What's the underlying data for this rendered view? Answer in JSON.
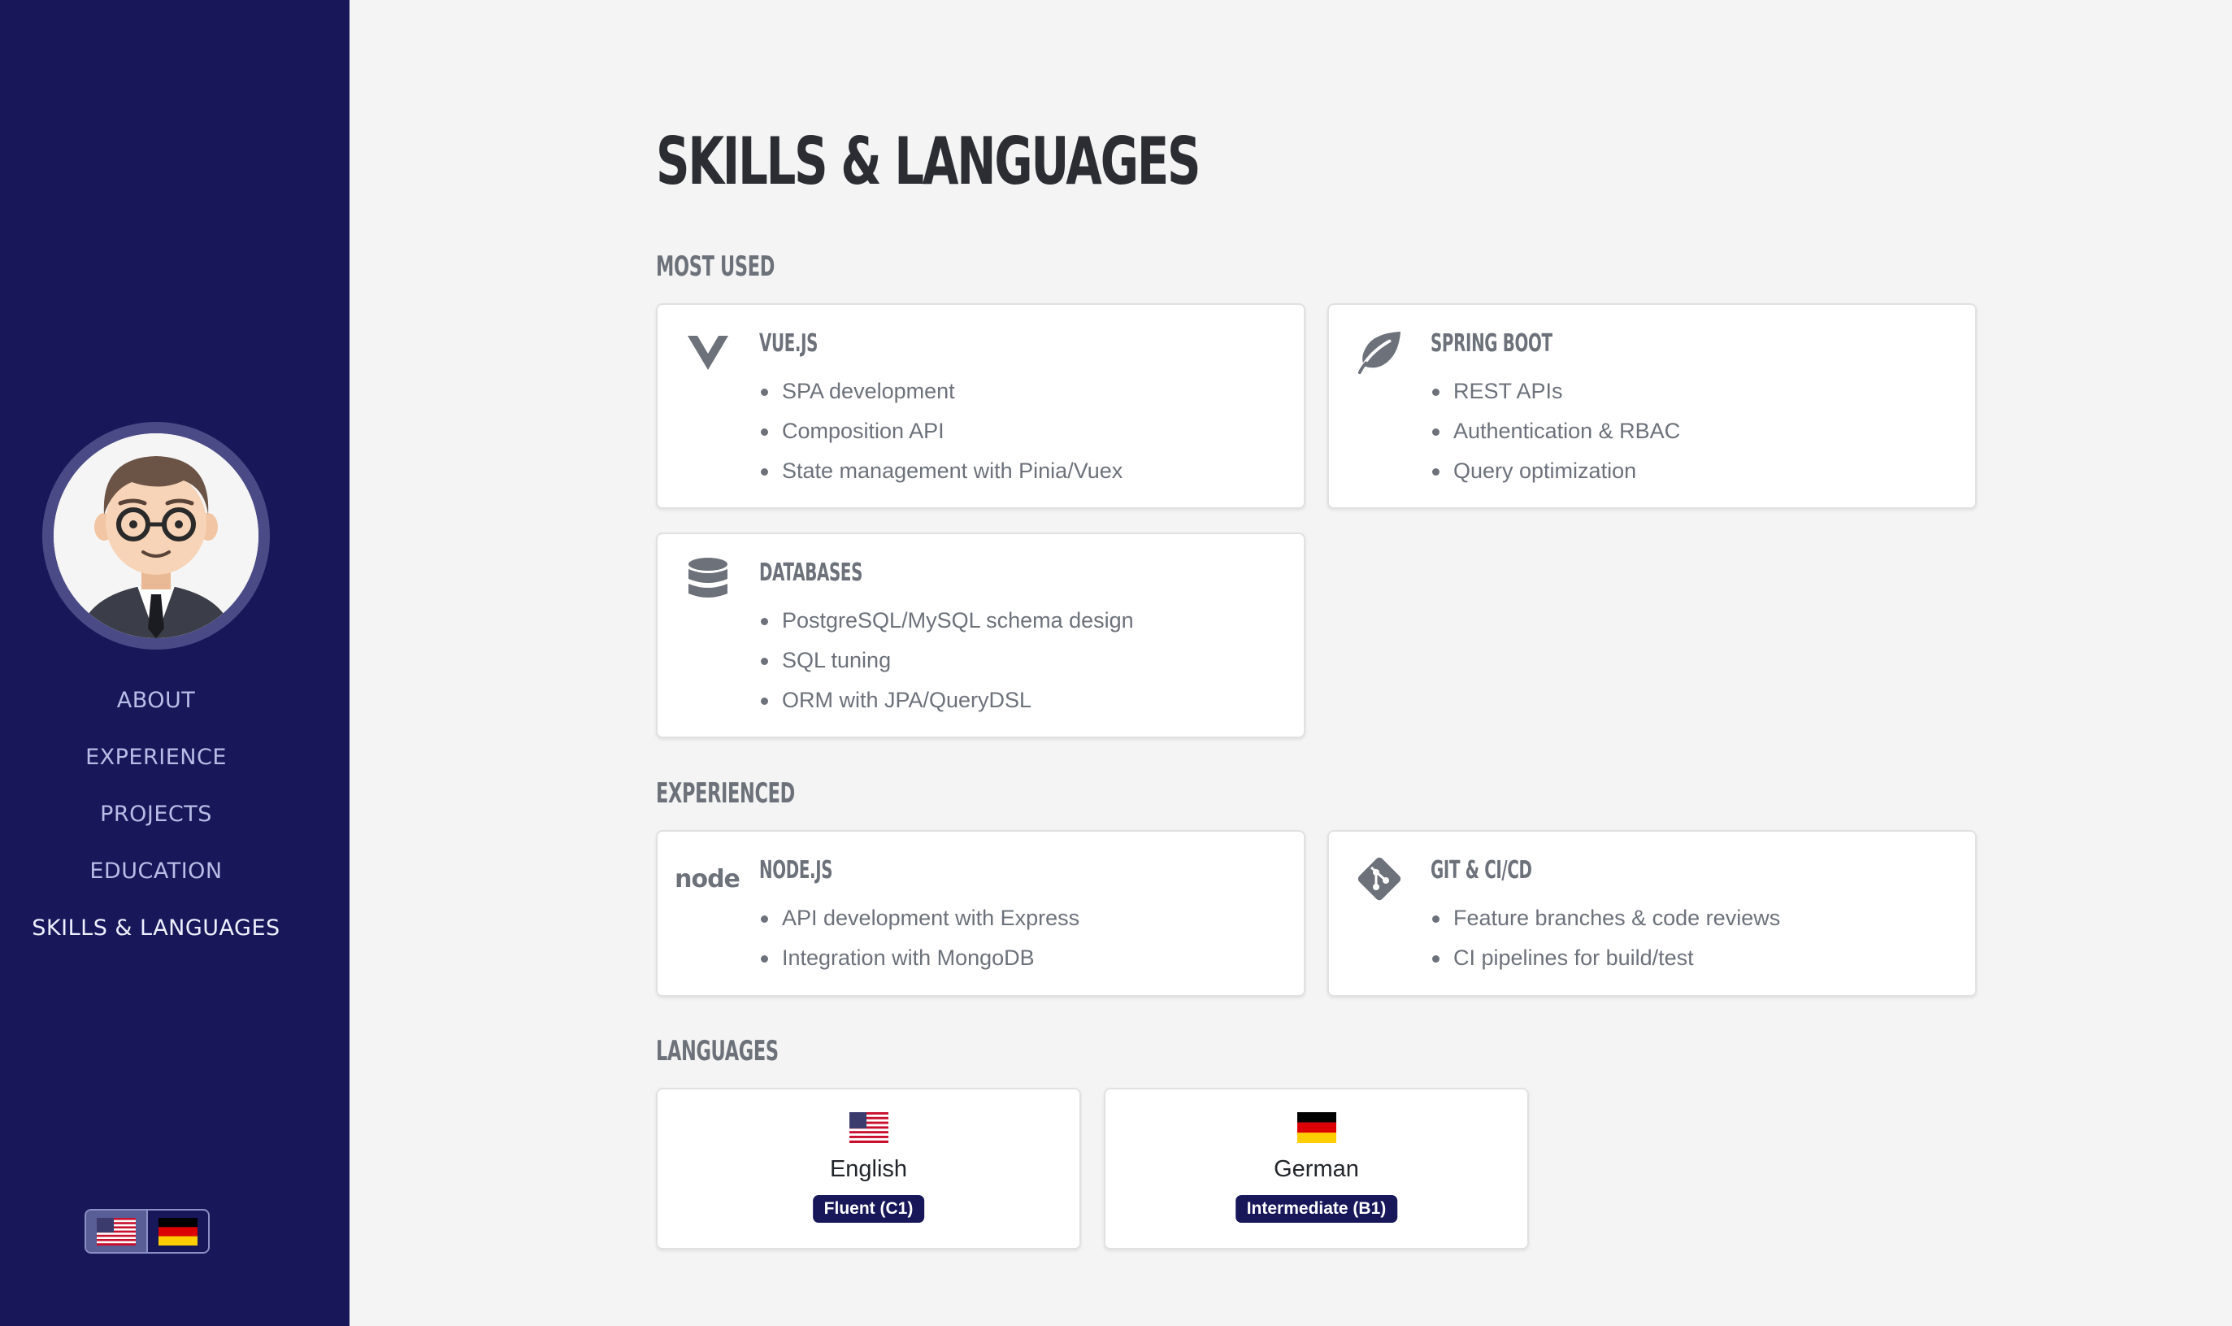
{
  "nav": {
    "items": [
      {
        "label": "ABOUT"
      },
      {
        "label": "EXPERIENCE"
      },
      {
        "label": "PROJECTS"
      },
      {
        "label": "EDUCATION"
      },
      {
        "label": "SKILLS & LANGUAGES",
        "active": true
      }
    ]
  },
  "language_switcher": {
    "selected": "en",
    "options": [
      "us-flag-icon",
      "de-flag-icon"
    ]
  },
  "page": {
    "title": "SKILLS & LANGUAGES"
  },
  "sections": {
    "most_used": "MOST USED",
    "experienced": "EXPERIENCED",
    "languages": "LANGUAGES"
  },
  "skills": {
    "vue": {
      "icon": "vue-icon",
      "title": "VUE.JS",
      "items": [
        "SPA development",
        "Composition API",
        "State management with Pinia/Vuex"
      ]
    },
    "spring": {
      "icon": "leaf-icon",
      "title": "SPRING BOOT",
      "items": [
        "REST APIs",
        "Authentication & RBAC",
        "Query optimization"
      ]
    },
    "databases": {
      "icon": "database-icon",
      "title": "DATABASES",
      "items": [
        "PostgreSQL/MySQL schema design",
        "SQL tuning",
        "ORM with JPA/QueryDSL"
      ]
    },
    "node": {
      "icon": "node-icon",
      "icon_text": "node",
      "title": "NODE.JS",
      "items": [
        "API development with Express",
        "Integration with MongoDB"
      ]
    },
    "git": {
      "icon": "git-icon",
      "title": "GIT & CI/CD",
      "items": [
        "Feature branches & code reviews",
        "CI pipelines for build/test"
      ]
    }
  },
  "languages": [
    {
      "flag": "us-flag-icon",
      "name": "English",
      "level": "Fluent (C1)"
    },
    {
      "flag": "de-flag-icon",
      "name": "German",
      "level": "Intermediate (B1)"
    }
  ],
  "colors": {
    "sidebar": "#17175a",
    "background": "#f4f4f4",
    "badge": "#17175a",
    "muted_text": "#6c717a"
  }
}
